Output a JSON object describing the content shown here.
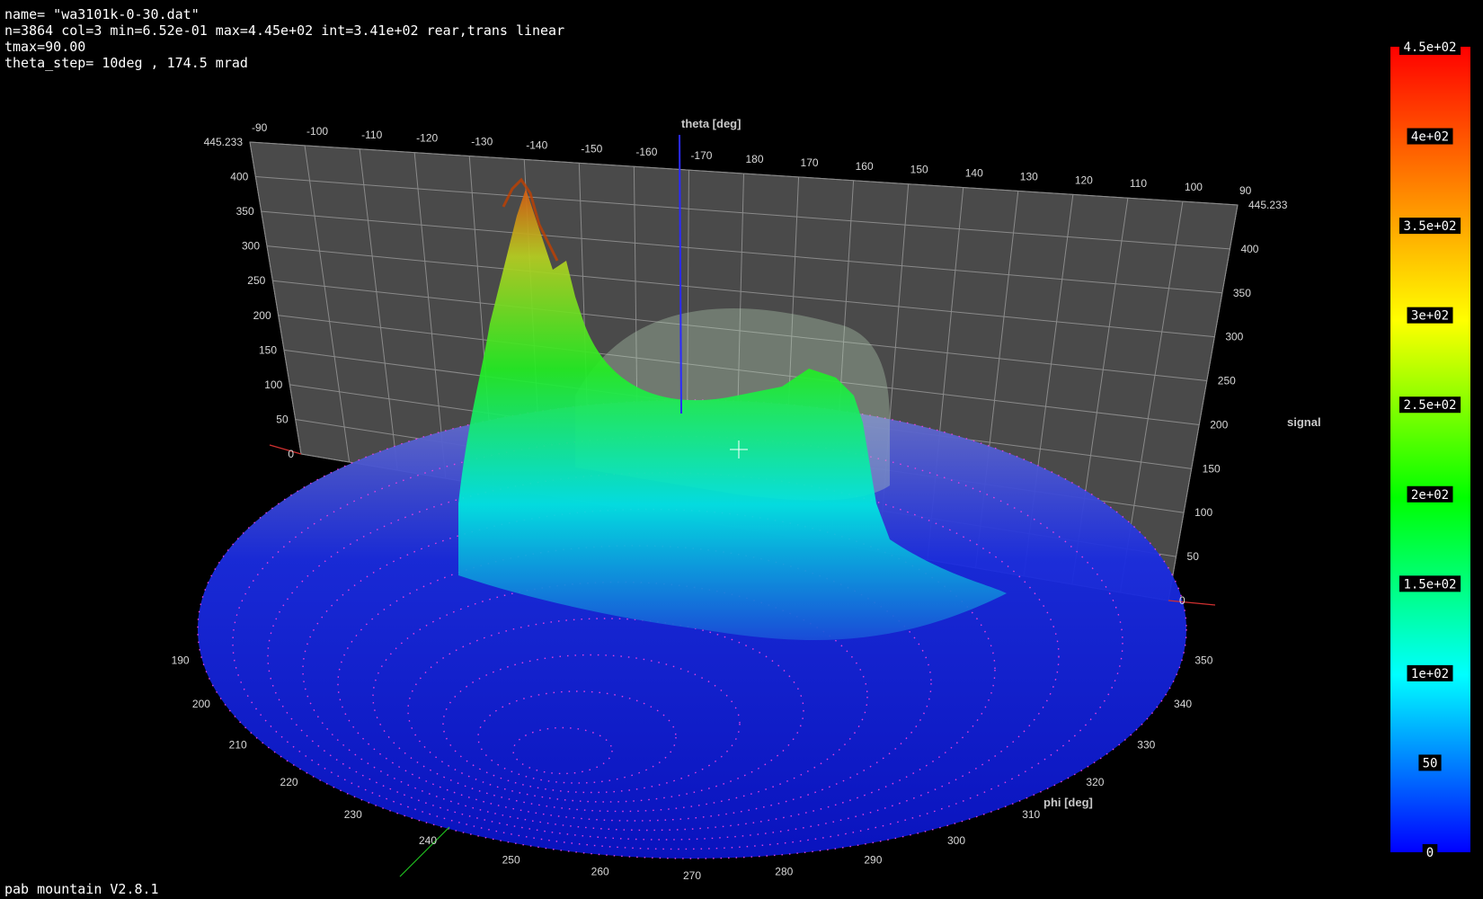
{
  "header": {
    "name_line": "name= \"wa3101k-0-30.dat\"",
    "stats_line": "n=3864 col=3 min=6.52e-01 max=4.45e+02 int=3.41e+02 rear,trans linear",
    "tmax_line": "tmax=90.00",
    "theta_step_line": "theta_step= 10deg , 174.5 mrad"
  },
  "footer": {
    "version": "pab mountain V2.8.1"
  },
  "chart_data": {
    "type": "surface3d",
    "axes": {
      "theta_label": "theta [deg]",
      "phi_label": "phi [deg]",
      "signal_label": "signal",
      "theta_ticks": [
        "-90",
        "-100",
        "-110",
        "-120",
        "-130",
        "-140",
        "-150",
        "-160",
        "-170",
        "180",
        "170",
        "160",
        "150",
        "140",
        "130",
        "120",
        "110",
        "100",
        "90"
      ],
      "signal_ticks_left": [
        "445.233",
        "400",
        "350",
        "300",
        "250",
        "200",
        "150",
        "100",
        "50",
        "0"
      ],
      "signal_ticks_right": [
        "445.233",
        "400",
        "350",
        "300",
        "250",
        "200",
        "150",
        "100",
        "50",
        "0"
      ],
      "phi_ticks": [
        "190",
        "200",
        "210",
        "220",
        "230",
        "240",
        "250",
        "260",
        "270",
        "280",
        "290",
        "300",
        "310",
        "320",
        "330",
        "340",
        "350"
      ],
      "signal_range": [
        0,
        445.233
      ],
      "tmax": 90.0
    },
    "colorbar": {
      "labels": [
        "4.5e+02",
        "4e+02",
        "3.5e+02",
        "3e+02",
        "2.5e+02",
        "2e+02",
        "1.5e+02",
        "1e+02",
        "50",
        "0"
      ],
      "range": [
        0,
        445
      ]
    },
    "summary": {
      "n": 3864,
      "min": 0.652,
      "max": 445,
      "integral": 341
    }
  }
}
